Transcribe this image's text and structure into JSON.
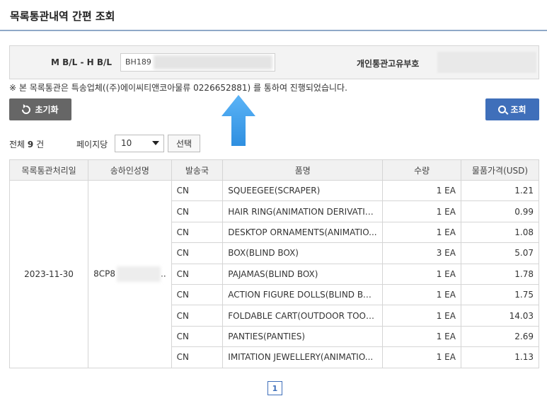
{
  "header": {
    "title": "목록통관내역 간편 조회"
  },
  "search": {
    "mbl_label": "M B/L - H B/L",
    "mbl_value": "BH189",
    "customs_id_label": "개인통관고유부호",
    "customs_id_value": ""
  },
  "notice": "※ 본 목록통관은 특송업체((주)에이씨티앤코아물류 0226652881) 를 통하여 진행되었습니다.",
  "buttons": {
    "reset_label": "초기화",
    "search_label": "조회",
    "select_label": "선택"
  },
  "paging": {
    "total_prefix": "전체",
    "total_count": "9",
    "total_suffix": "건",
    "per_page_label": "페이지당",
    "per_page_value": "10",
    "pages": [
      "1"
    ]
  },
  "table": {
    "headers": [
      "목록통관처리일",
      "송하인성명",
      "발송국",
      "품명",
      "수량",
      "물품가격(USD)"
    ],
    "date": "2023-11-30",
    "shipper": "8CP8",
    "shipper_suffix": "..",
    "rows": [
      {
        "origin": "CN",
        "item": "SQUEEGEE(SCRAPER)",
        "qty": "1 EA",
        "price": "1.21"
      },
      {
        "origin": "CN",
        "item": "HAIR RING(ANIMATION DERIVATIV...",
        "qty": "1 EA",
        "price": "0.99"
      },
      {
        "origin": "CN",
        "item": "DESKTOP ORNAMENTS(ANIMATIO...",
        "qty": "1 EA",
        "price": "1.08"
      },
      {
        "origin": "CN",
        "item": "BOX(BLIND BOX)",
        "qty": "3 EA",
        "price": "5.07"
      },
      {
        "origin": "CN",
        "item": "PAJAMAS(BLIND BOX)",
        "qty": "1 EA",
        "price": "1.78"
      },
      {
        "origin": "CN",
        "item": "ACTION FIGURE DOLLS(BLIND BOX)",
        "qty": "1 EA",
        "price": "1.75"
      },
      {
        "origin": "CN",
        "item": "FOLDABLE CART(OUTDOOR TOOLS)",
        "qty": "1 EA",
        "price": "14.03"
      },
      {
        "origin": "CN",
        "item": "PANTIES(PANTIES)",
        "qty": "1 EA",
        "price": "2.69"
      },
      {
        "origin": "CN",
        "item": "IMITATION JEWELLERY(ANIMATIO...",
        "qty": "1 EA",
        "price": "1.13"
      }
    ]
  },
  "colors": {
    "primary": "#3f6fba",
    "reset": "#666666",
    "arrow": "#42a5f5",
    "title_rule": "#8fa9c8"
  },
  "icons": {
    "reset": "refresh-icon",
    "search": "search-icon",
    "annotation": "up-arrow-icon",
    "select": "chevron-down-icon"
  }
}
